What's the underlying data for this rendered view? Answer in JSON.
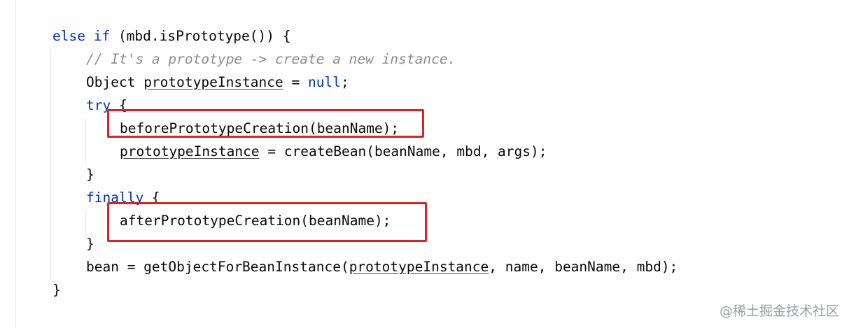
{
  "editor": {
    "lines": {
      "l1": {
        "kw_else": "else",
        "kw_if": "if",
        "rest": " (mbd.isPrototype()) {"
      },
      "l2": {
        "comment": "// It's a prototype -> create a new instance."
      },
      "l3": {
        "type": "Object ",
        "var": "prototypeInstance",
        "assign": " = ",
        "kw_null": "null",
        "end": ";"
      },
      "l4": {
        "kw_try": "try",
        "brace": " {"
      },
      "l5": {
        "call": "beforePrototypeCreation(beanName);"
      },
      "l6": {
        "var": "prototypeInstance",
        "rest": " = createBean(beanName, mbd, args);"
      },
      "l7": {
        "brace": "}"
      },
      "l8": {
        "kw_finally": "finally",
        "brace": " {"
      },
      "l9": {
        "call": "afterPrototypeCreation(beanName);"
      },
      "l10": {
        "brace": "}"
      },
      "l11": {
        "start": "bean = getObjectForBeanInstance(",
        "var": "prototypeInstance",
        "rest": ", name, beanName, mbd);"
      },
      "l12": {
        "brace": "}"
      }
    },
    "highlight_color": "#e02020",
    "keyword_color": "#0033b3",
    "comment_color": "#8c8c8c"
  },
  "watermark": {
    "text": "@稀土掘金技术社区"
  }
}
